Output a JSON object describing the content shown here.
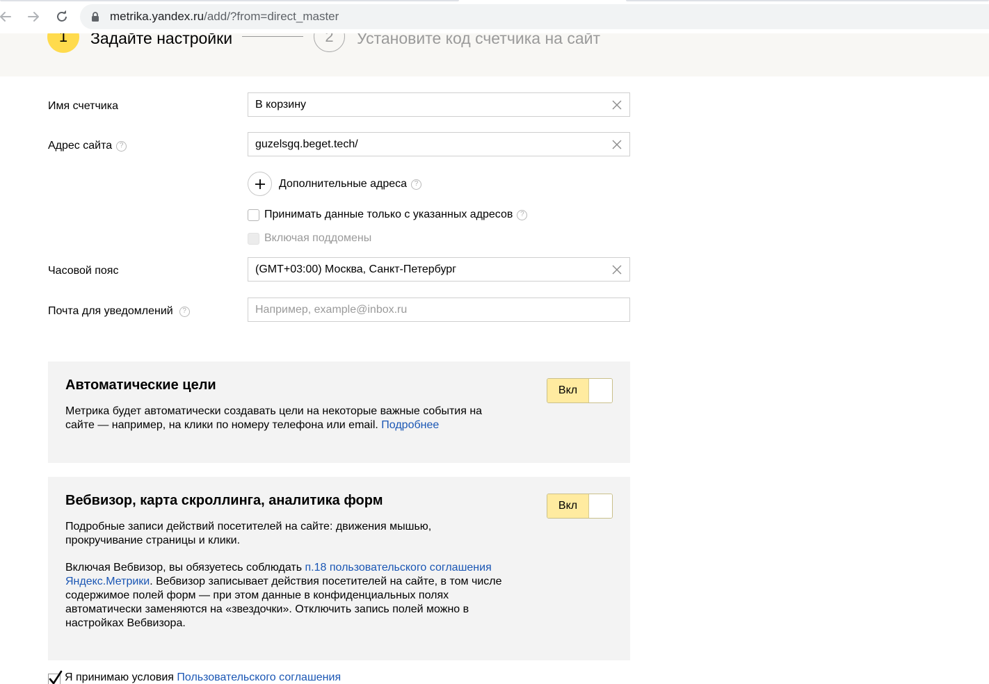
{
  "browser": {
    "url_host": "metrika.yandex.ru",
    "url_path": "/add/?from=direct_master"
  },
  "stepper": {
    "step1_number": "1",
    "step1_title": "Задайте настройки",
    "step2_number": "2",
    "step2_title": "Установите код счетчика на сайт"
  },
  "form": {
    "counter_name": {
      "label": "Имя счетчика",
      "value": "В корзину"
    },
    "site_address": {
      "label": "Адрес сайта",
      "value": "guzelsgq.beget.tech/"
    },
    "additional_addresses_label": "Дополнительные адреса",
    "accept_only_label": "Принимать данные только с указанных адресов",
    "accept_only_checked": false,
    "include_subdomains_label": "Включая поддомены",
    "timezone": {
      "label": "Часовой пояс",
      "value": "(GMT+03:00) Москва, Санкт-Петербург"
    },
    "notify_email": {
      "label": "Почта для уведомлений",
      "placeholder": "Например, example@inbox.ru"
    }
  },
  "auto_goals": {
    "title": "Автоматические цели",
    "text": "Метрика будет автоматически создавать цели на некоторые важные события на сайте — например, на клики по номеру телефона или email.",
    "link": "Подробнее",
    "toggle_label": "Вкл"
  },
  "webvisor": {
    "title": "Вебвизор, карта скроллинга, аналитика форм",
    "text1": "Подробные записи действий посетителей на сайте: движения мышью, прокручивание страницы и клики.",
    "text2_before": "Включая Вебвизор, вы обязуетесь соблюдать",
    "text2_link": "п.18 пользовательского соглашения Яндекс.Метрики",
    "text2_after": ". Вебвизор записывает действия посетителей на сайте, в том числе содержимое полей форм — при этом данные в конфиденциальных полях автоматически заменяются на «звездочки». Отключить запись полей можно в настройках Вебвизора.",
    "toggle_label": "Вкл"
  },
  "agreement": {
    "text": "Я принимаю условия",
    "link": "Пользовательского соглашения",
    "checked": true
  }
}
